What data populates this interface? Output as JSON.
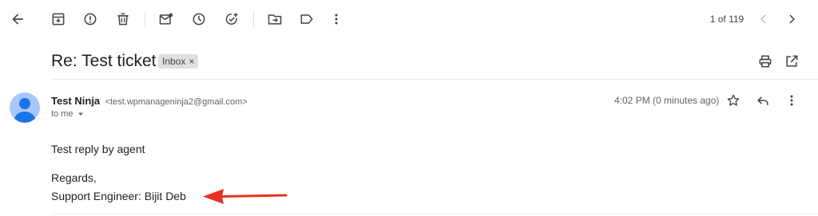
{
  "toolbar": {
    "pager_text": "1 of 119"
  },
  "subject": {
    "title": "Re: Test ticket",
    "label_chip": "Inbox",
    "label_remove": "×"
  },
  "message": {
    "sender_name": "Test Ninja",
    "sender_email": "<test.wpmanageninja2@gmail.com>",
    "recipient": "to me",
    "time": "4:02 PM (0 minutes ago)",
    "body": {
      "line1": "Test reply by agent",
      "line2": "Regards,",
      "line3": "Support Engineer: Bijit Deb"
    }
  },
  "colors": {
    "arrow": "#e8321e",
    "avatar_bg": "#a8c7fa",
    "avatar_fg": "#1a73e8"
  },
  "icons": [
    "back-arrow-icon",
    "archive-icon",
    "report-spam-icon",
    "delete-icon",
    "mark-unread-icon",
    "snooze-icon",
    "add-task-icon",
    "move-to-icon",
    "label-icon",
    "more-vert-icon",
    "chevron-left-icon",
    "chevron-right-icon",
    "print-icon",
    "open-new-window-icon",
    "star-icon",
    "reply-icon",
    "dropdown-caret-icon",
    "avatar-person-icon"
  ]
}
